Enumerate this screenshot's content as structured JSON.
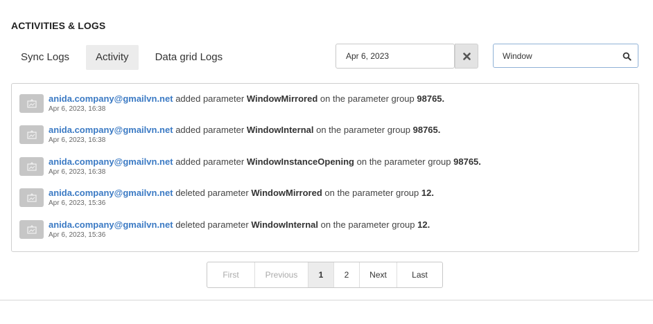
{
  "page": {
    "title": "ACTIVITIES & LOGS"
  },
  "tabs": [
    {
      "label": "Sync Logs",
      "active": false
    },
    {
      "label": "Activity",
      "active": true
    },
    {
      "label": "Data grid Logs",
      "active": false
    }
  ],
  "filters": {
    "date_value": "Apr 6, 2023",
    "clear_icon": "close-icon",
    "search_value": "Window",
    "search_icon": "search-icon"
  },
  "logs": [
    {
      "user": "anida.company@gmailvn.net",
      "action": "added parameter",
      "parameter": "WindowMirrored",
      "middle": "on the parameter group",
      "group": "98765.",
      "time": "Apr 6, 2023, 16:38",
      "icon": "image-placeholder-icon"
    },
    {
      "user": "anida.company@gmailvn.net",
      "action": "added parameter",
      "parameter": "WindowInternal",
      "middle": "on the parameter group",
      "group": "98765.",
      "time": "Apr 6, 2023, 16:38",
      "icon": "image-placeholder-icon"
    },
    {
      "user": "anida.company@gmailvn.net",
      "action": "added parameter",
      "parameter": "WindowInstanceOpening",
      "middle": "on the parameter group",
      "group": "98765.",
      "time": "Apr 6, 2023, 16:38",
      "icon": "image-placeholder-icon"
    },
    {
      "user": "anida.company@gmailvn.net",
      "action": "deleted parameter",
      "parameter": "WindowMirrored",
      "middle": "on the parameter group",
      "group": "12.",
      "time": "Apr 6, 2023, 15:36",
      "icon": "image-placeholder-icon"
    },
    {
      "user": "anida.company@gmailvn.net",
      "action": "deleted parameter",
      "parameter": "WindowInternal",
      "middle": "on the parameter group",
      "group": "12.",
      "time": "Apr 6, 2023, 15:36",
      "icon": "image-placeholder-icon"
    }
  ],
  "pagination": {
    "first": "First",
    "previous": "Previous",
    "pages": [
      "1",
      "2"
    ],
    "current_page": "1",
    "next": "Next",
    "last": "Last"
  },
  "colors": {
    "link": "#3b7ac4",
    "active_tab_bg": "#ececec",
    "search_border": "#8fb1d6",
    "avatar_bg": "#c6c6c6"
  }
}
